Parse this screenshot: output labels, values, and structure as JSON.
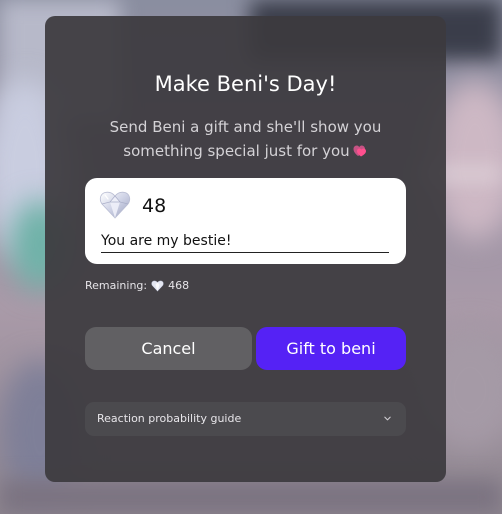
{
  "modal": {
    "title": "Make Beni's Day!",
    "subtitle_line1": "Send Beni a gift and she'll show you",
    "subtitle_line2": "something special just for you",
    "subtitle_icon": "pink-hearts-icon"
  },
  "gift": {
    "icon": "diamond-heart-icon",
    "amount": "48",
    "message_value": "You are my bestie!"
  },
  "balance": {
    "label": "Remaining:",
    "icon": "diamond-heart-icon",
    "value": "468"
  },
  "actions": {
    "cancel_label": "Cancel",
    "gift_label": "Gift to beni"
  },
  "guide": {
    "label": "Reaction probability guide",
    "icon": "chevron-down-icon"
  },
  "colors": {
    "modal_bg": "#3c3a3e",
    "gift_button": "#5522f5",
    "cancel_button": "#616063",
    "card_bg": "#ffffff"
  }
}
